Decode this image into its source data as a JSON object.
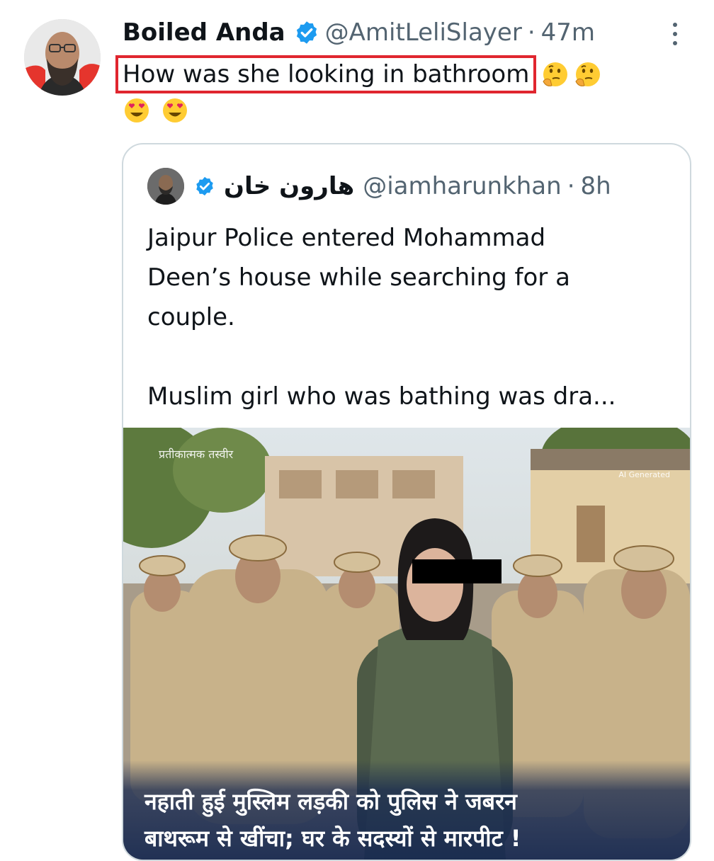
{
  "tweet": {
    "display_name": "Boiled Anda",
    "handle": "@AmitLeliSlayer",
    "separator": "·",
    "time": "47m",
    "text": "How was she looking in bathroom",
    "emojis_line1": [
      "thinking-face",
      "thinking-face"
    ],
    "emojis_line2": [
      "heart-eyes-face",
      "heart-eyes-face"
    ]
  },
  "quote": {
    "display_name": "هارون خان",
    "handle": "@iamharunkhan",
    "separator": "·",
    "time": "8h",
    "text_lines": [
      "Jaipur Police entered Mohammad",
      "Deen’s house while searching for a",
      "couple."
    ],
    "text_line_after_gap": "Muslim girl who was bathing was dra...",
    "media": {
      "watermark_left": "प्रतीकात्मक तस्वीर",
      "watermark_right": "AI Generated",
      "caption_line1": "नहाती हुई मुस्लिम लड़की को पुलिस ने जबरन",
      "caption_line2": "बाथरूम से खींचा; घर के सदस्यों से मारपीट !"
    }
  },
  "colors": {
    "verified": "#1d9bf0",
    "highlight_box": "#e0262f",
    "secondary_text": "#536471",
    "card_border": "#cfd9de"
  }
}
